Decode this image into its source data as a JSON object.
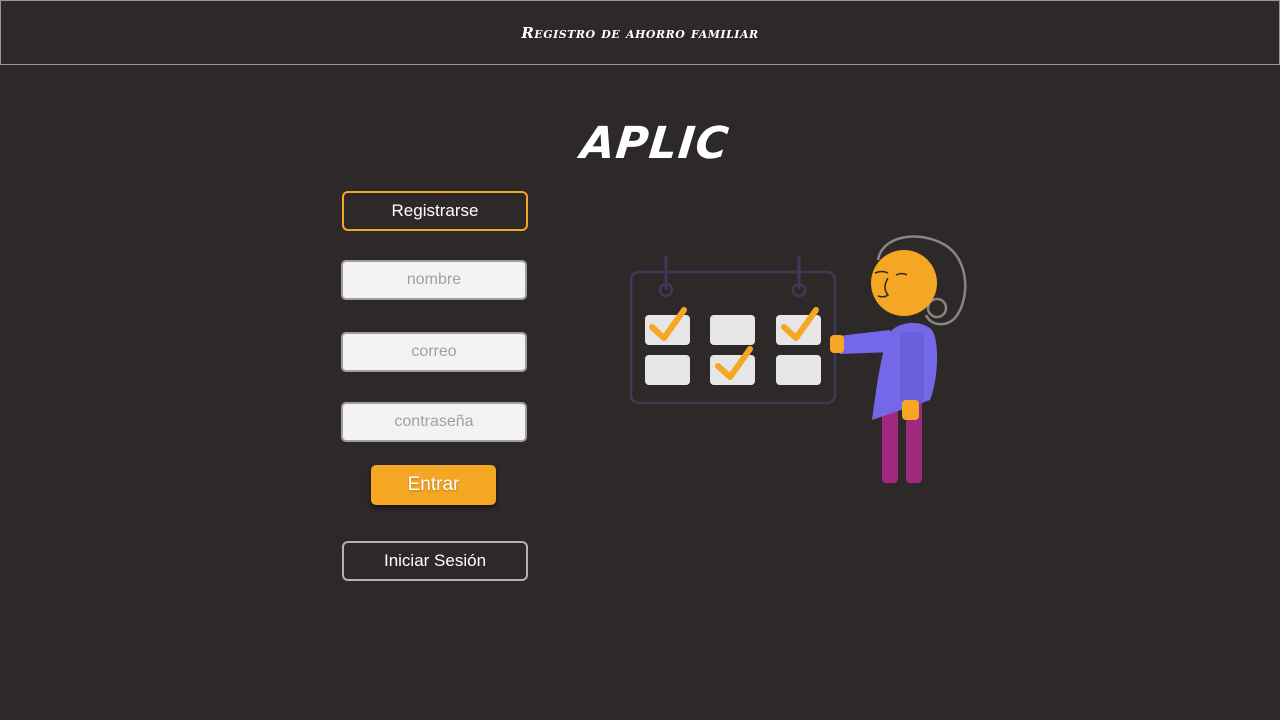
{
  "header": {
    "title": "Registro de ahorro familiar"
  },
  "brand": {
    "name": "APLIC"
  },
  "form": {
    "register_label": "Registrarse",
    "name_placeholder": "nombre",
    "email_placeholder": "correo",
    "password_placeholder": "contraseña",
    "submit_label": "Entrar",
    "login_label": "Iniciar Sesión"
  },
  "illustration": {
    "name": "calendar-checklist-illustration",
    "checked_cells": [
      1,
      3,
      5
    ],
    "colors": {
      "accent": "#f5a623",
      "shirt": "#7468e8",
      "pants": "#a0287e",
      "outline": "#3e3a55",
      "cell": "#e6e6e6"
    }
  },
  "colors": {
    "background": "#2e2929",
    "accent": "#f5a623",
    "field_bg": "#f3f3f3",
    "placeholder": "#a59f9f"
  }
}
